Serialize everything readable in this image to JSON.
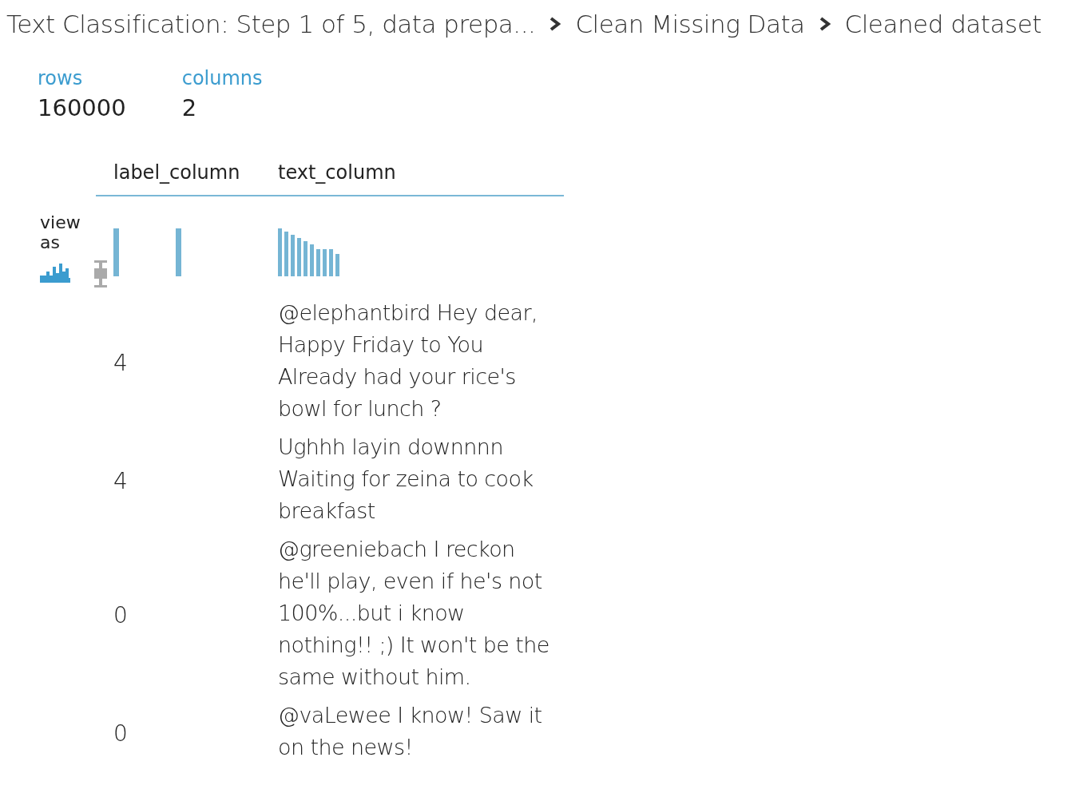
{
  "breadcrumb": [
    {
      "label": "Text Classification: Step 1 of 5, data prepa..."
    },
    {
      "label": "Clean Missing Data"
    },
    {
      "label": "Cleaned dataset"
    }
  ],
  "stats": [
    {
      "label": "rows",
      "value": "160000"
    },
    {
      "label": "columns",
      "value": "2"
    }
  ],
  "view_as": {
    "label": "view as",
    "options": [
      {
        "kind": "histogram",
        "selected": true
      },
      {
        "kind": "boxplot",
        "selected": false
      }
    ]
  },
  "table": {
    "columns": [
      {
        "name": "label_column"
      },
      {
        "name": "text_column"
      }
    ],
    "rows": [
      {
        "label_column": "4",
        "text_column": "@elephantbird Hey dear, Happy Friday to You  Already had your rice's bowl for lunch ?"
      },
      {
        "label_column": "4",
        "text_column": "Ughhh layin downnnn    Waiting for zeina to cook breakfast"
      },
      {
        "label_column": "0",
        "text_column": "@greeniebach I reckon he'll play, even if he's not 100%...but i know nothing!! ;) It won't be the same without him."
      },
      {
        "label_column": "0",
        "text_column": "@vaLewee I know! Saw it on the news!"
      }
    ]
  }
}
